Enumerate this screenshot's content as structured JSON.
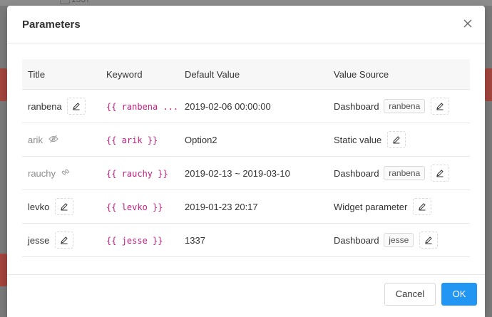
{
  "background": {
    "fragment_text": "1337"
  },
  "modal": {
    "title": "Parameters",
    "close_icon": "close-icon"
  },
  "table": {
    "headers": [
      "Title",
      "Keyword",
      "Default Value",
      "Value Source"
    ],
    "rows": [
      {
        "title": "ranbena",
        "title_muted": false,
        "title_icon": "edit-icon",
        "keyword": "{{ ranbena ...",
        "default_value": "2019-02-06 00:00:00",
        "source": "Dashboard",
        "source_tag": "ranbena",
        "source_edit": true
      },
      {
        "title": "arik",
        "title_muted": true,
        "title_icon": "eye-slash-icon",
        "keyword": "{{ arik }}",
        "default_value": "Option2",
        "source": "Static value",
        "source_tag": "",
        "source_edit": true
      },
      {
        "title": "rauchy",
        "title_muted": true,
        "title_icon": "link-icon",
        "keyword": "{{ rauchy }}",
        "default_value": "2019-02-13 ~ 2019-03-10",
        "source": "Dashboard",
        "source_tag": "ranbena",
        "source_edit": true
      },
      {
        "title": "levko",
        "title_muted": false,
        "title_icon": "edit-icon",
        "keyword": "{{ levko }}",
        "default_value": "2019-01-23 20:17",
        "source": "Widget parameter",
        "source_tag": "",
        "source_edit": true
      },
      {
        "title": "jesse",
        "title_muted": false,
        "title_icon": "edit-icon",
        "keyword": "{{ jesse }}",
        "default_value": "1337",
        "source": "Dashboard",
        "source_tag": "jesse",
        "source_edit": true
      }
    ]
  },
  "footer": {
    "cancel_label": "Cancel",
    "ok_label": "OK"
  },
  "colors": {
    "primary": "#2196f3",
    "keyword": "#c41d7f",
    "muted_text": "#8c8c8c"
  }
}
